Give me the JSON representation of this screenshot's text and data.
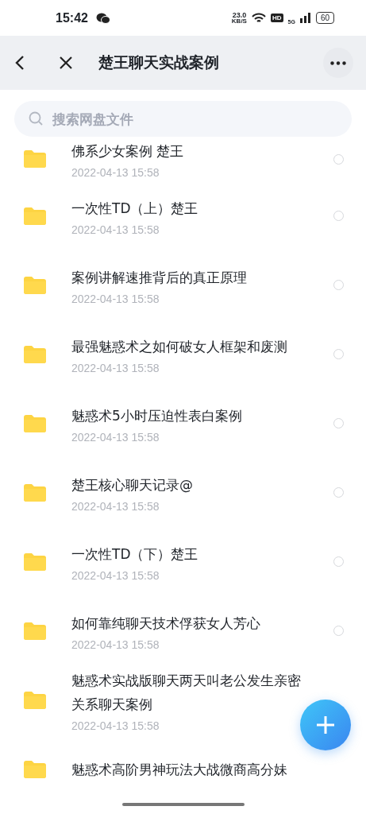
{
  "status_bar": {
    "time": "15:42",
    "net_speed": "23.0",
    "net_unit": "KB/S",
    "hd": "HD",
    "network": "5G",
    "battery": "60"
  },
  "header": {
    "title": "楚王聊天实战案例"
  },
  "search": {
    "placeholder": "搜索网盘文件"
  },
  "files": [
    {
      "name": "佛系少女案例 楚王",
      "date": "2022-04-13  15:58",
      "selected": false
    },
    {
      "name": "一次性TD（上）楚王",
      "date": "2022-04-13  15:58",
      "selected": false
    },
    {
      "name": "案例讲解速推背后的真正原理",
      "date": "2022-04-13  15:58",
      "selected": false
    },
    {
      "name": "最强魅惑术之如何破女人框架和废测",
      "date": "2022-04-13  15:58",
      "selected": false
    },
    {
      "name": "魅惑术5小时压迫性表白案例",
      "date": "2022-04-13  15:58",
      "selected": false
    },
    {
      "name": "楚王核心聊天记录@",
      "date": "2022-04-13  15:58",
      "selected": false
    },
    {
      "name": "一次性TD（下）楚王",
      "date": "2022-04-13  15:58",
      "selected": false
    },
    {
      "name": "如何靠纯聊天技术俘获女人芳心",
      "date": "2022-04-13  15:58",
      "selected": false
    },
    {
      "name": "魅惑术实战版聊天两天叫老公发生亲密关系聊天案例",
      "date": "2022-04-13  15:58"
    },
    {
      "name": "魅惑术高阶男神玩法大战微商高分妹"
    }
  ]
}
